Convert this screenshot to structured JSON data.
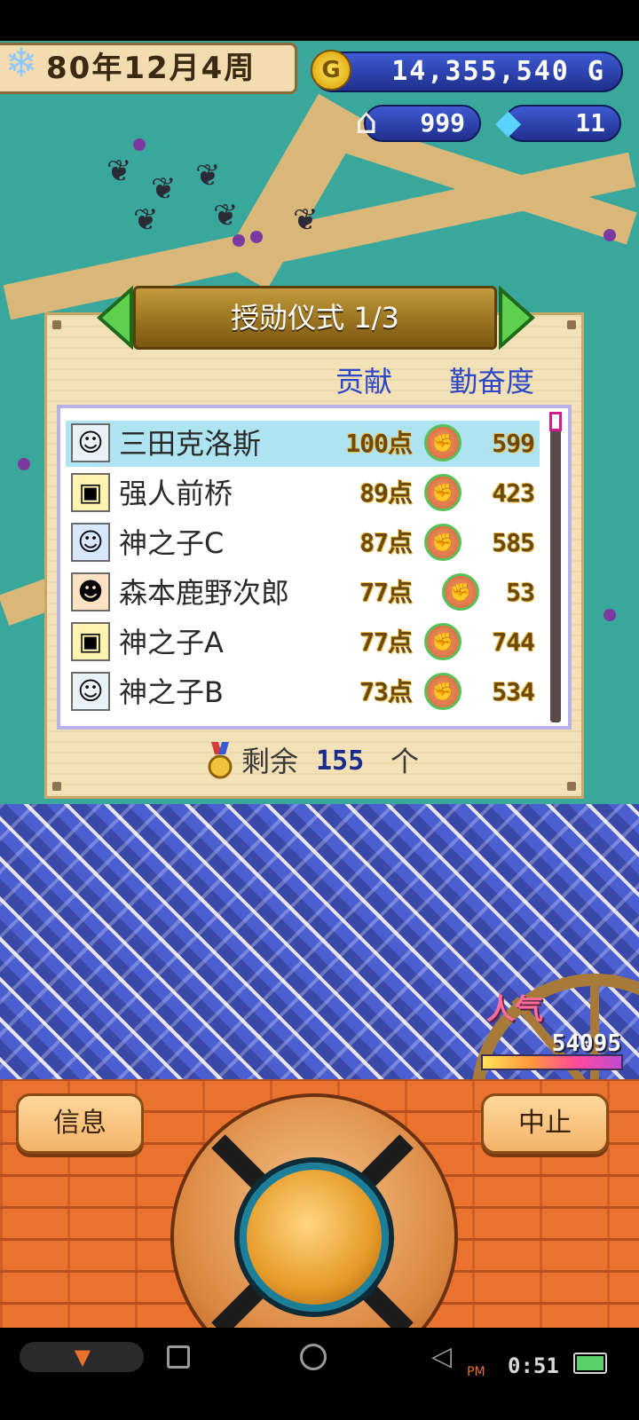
{
  "hud": {
    "date": "80年12月4周",
    "money": "14,355,540 G",
    "coin_symbol": "G",
    "houses": "999",
    "gems": "11"
  },
  "panel": {
    "title": "授勋仪式 1/3",
    "col_contribution": "贡献",
    "col_diligence": "勤奋度",
    "rows": [
      {
        "name": "三田克洛斯",
        "points": "100点",
        "diligence": "599",
        "avatar": "green-hair-avatar"
      },
      {
        "name": "强人前桥",
        "points": "89点",
        "diligence": "423",
        "avatar": "robot-avatar"
      },
      {
        "name": "神之子C",
        "points": "87点",
        "diligence": "585",
        "avatar": "blue-hair-avatar"
      },
      {
        "name": "森本鹿野次郎",
        "points": "77点",
        "diligence": "53",
        "avatar": "sunglasses-avatar"
      },
      {
        "name": "神之子A",
        "points": "77点",
        "diligence": "744",
        "avatar": "robot-avatar"
      },
      {
        "name": "神之子B",
        "points": "73点",
        "diligence": "534",
        "avatar": "green-hair-avatar"
      }
    ],
    "remaining_label": "剩余",
    "remaining_value": "155",
    "remaining_unit": "个"
  },
  "popularity": {
    "label": "人气",
    "value": "54095"
  },
  "controls": {
    "info_label": "信息",
    "stop_label": "中止"
  },
  "system": {
    "ampm": "PM",
    "time": "0:51"
  },
  "colors": {
    "accent_blue": "#2d47c6",
    "panel_bg": "#f3e2b8",
    "selected_row": "#aee3f2",
    "brick": "#e8722e"
  }
}
